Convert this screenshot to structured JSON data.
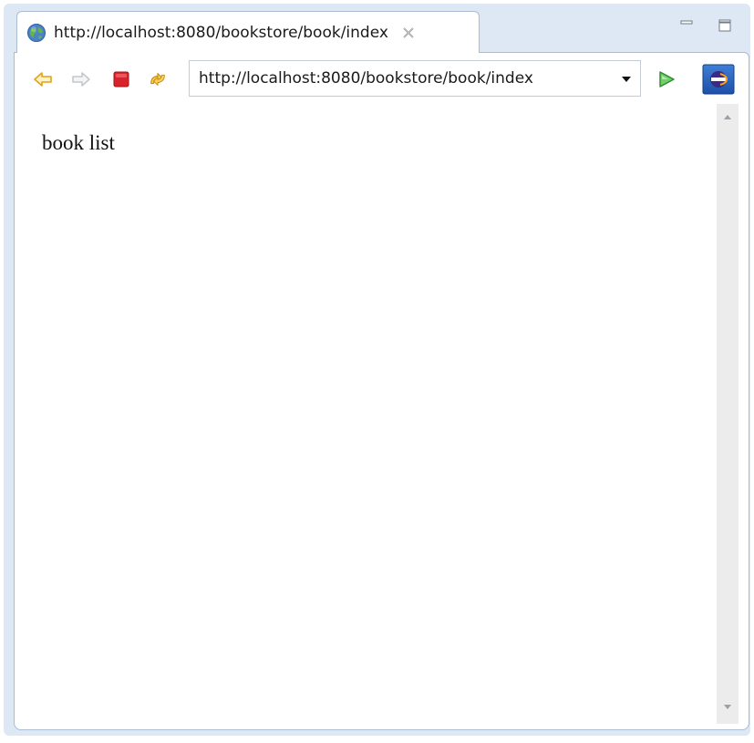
{
  "tab": {
    "title": "http://localhost:8080/bookstore/book/index",
    "icon": "globe-icon",
    "close_icon": "close-icon"
  },
  "window_controls": {
    "minimize_icon": "minimize-icon",
    "maximize_icon": "maximize-icon"
  },
  "toolbar": {
    "back_icon": "back-arrow-icon",
    "forward_icon": "forward-arrow-icon",
    "stop_icon": "stop-icon",
    "refresh_icon": "refresh-icon",
    "go_icon": "go-icon",
    "eclipse_icon": "eclipse-icon"
  },
  "address_bar": {
    "value": "http://localhost:8080/bookstore/book/index",
    "dropdown_icon": "chevron-down-icon"
  },
  "page": {
    "text": "book list"
  },
  "colors": {
    "window_frame": "#dde8f4",
    "tab_border": "#a9bcd2",
    "stop_red": "#d8232a",
    "go_green": "#3aa83a",
    "arrow_yellow": "#e4a81c",
    "arrow_disabled": "#c4c8cc"
  }
}
